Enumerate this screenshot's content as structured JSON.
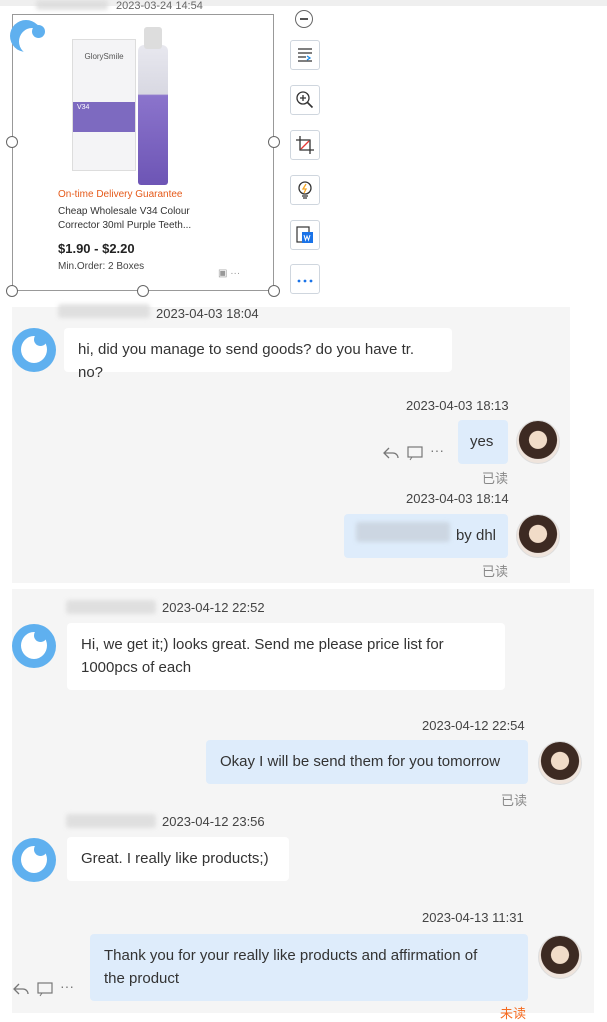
{
  "product_card": {
    "timestamp": "2023-03-24 14:54",
    "brand": "GlorySmile",
    "box_label": "V34",
    "guarantee": "On-time Delivery Guarantee",
    "title_line1": "Cheap Wholesale V34 Colour",
    "title_line2": "Corrector 30ml Purple Teeth...",
    "price": "$1.90 - $2.20",
    "min_order": "Min.Order: 2 Boxes"
  },
  "messages": [
    {
      "timestamp": "2023-04-03 18:04",
      "text": "hi, did you manage to send goods? do you have tr. no?"
    },
    {
      "timestamp": "2023-04-03 18:13",
      "text": "yes",
      "status": "已读"
    },
    {
      "timestamp": "2023-04-03 18:14",
      "text": "by dhl",
      "status": "已读"
    },
    {
      "timestamp": "2023-04-12 22:52",
      "text_line1": "Hi, we get it;) looks great. Send me please price list for",
      "text_line2": "1000pcs of each"
    },
    {
      "timestamp": "2023-04-12 22:54",
      "text": "Okay I will be send them for you tomorrow",
      "status": "已读"
    },
    {
      "timestamp": "2023-04-12 23:56",
      "text": "Great. I really like products;)"
    },
    {
      "timestamp": "2023-04-13 11:31",
      "text_line1": "Thank you for your really like products and affirmation of",
      "text_line2": "the product",
      "status": "未读"
    }
  ],
  "icons": {
    "collapse": "minus-circle-icon",
    "tools": [
      "text-recognition-icon",
      "zoom-in-icon",
      "crop-icon",
      "lightbulb-icon",
      "word-export-icon",
      "more-icon"
    ]
  }
}
